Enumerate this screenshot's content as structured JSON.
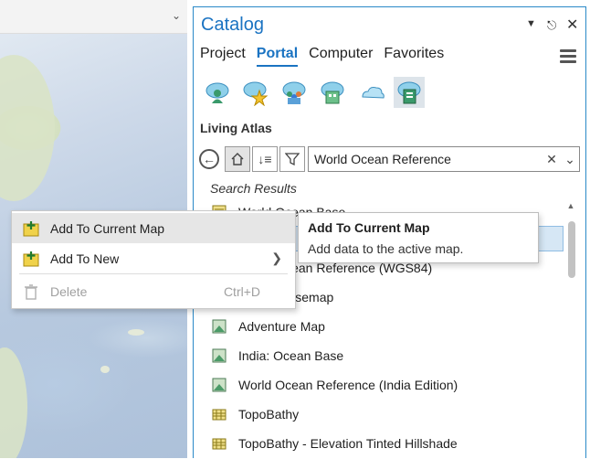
{
  "catalog": {
    "title": "Catalog",
    "tabs": [
      {
        "label": "Project",
        "active": false
      },
      {
        "label": "Portal",
        "active": true
      },
      {
        "label": "Computer",
        "active": false
      },
      {
        "label": "Favorites",
        "active": false
      }
    ],
    "source_buttons": [
      "my-content-icon",
      "favorites-icon",
      "groups-icon",
      "organization-icon",
      "arcgis-online-icon",
      "living-atlas-icon"
    ],
    "section_title": "Living Atlas",
    "search": {
      "value": "World Ocean Reference"
    },
    "results_label": "Search Results",
    "results": [
      {
        "label": "World Ocean Base",
        "icon": "basemap-layer-icon"
      },
      {
        "label": "",
        "icon": "map-icon",
        "selected": true
      },
      {
        "label": "World Ocean Reference (WGS84)",
        "icon": "layer-icon"
      },
      {
        "label": "Ocean Basemap",
        "icon": "map-icon"
      },
      {
        "label": "Adventure Map",
        "icon": "map-icon"
      },
      {
        "label": "India: Ocean Base",
        "icon": "map-icon"
      },
      {
        "label": "World Ocean Reference (India Edition)",
        "icon": "map-icon"
      },
      {
        "label": "TopoBathy",
        "icon": "tile-layer-icon"
      },
      {
        "label": "TopoBathy - Elevation Tinted Hillshade",
        "icon": "tile-layer-icon"
      }
    ]
  },
  "context_menu": {
    "items": [
      {
        "label": "Add To Current Map",
        "icon": "add-data-icon",
        "highlighted": true
      },
      {
        "label": "Add To New",
        "icon": "add-data-icon",
        "has_submenu": true
      },
      {
        "label": "Delete",
        "icon": "trash-icon",
        "shortcut": "Ctrl+D",
        "disabled": true
      }
    ]
  },
  "tooltip": {
    "title": "Add To Current Map",
    "description": "Add data to the active map."
  },
  "colors": {
    "accent": "#1a73c2",
    "selection": "#d6e7f5"
  }
}
